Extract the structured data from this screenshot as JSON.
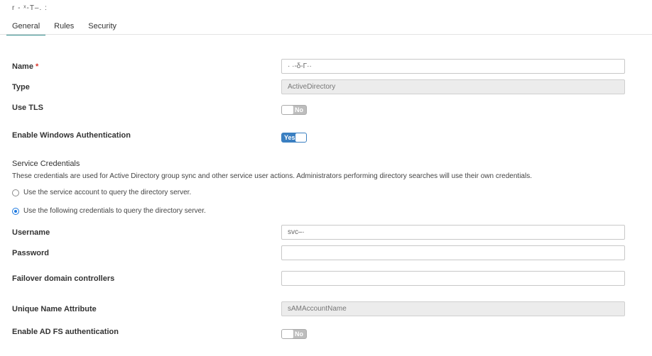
{
  "header": {
    "title": "r - ˣ-T–. :"
  },
  "tabs": [
    {
      "label": "General"
    },
    {
      "label": "Rules"
    },
    {
      "label": "Security"
    }
  ],
  "form": {
    "name": {
      "label": "Name",
      "required_marker": "*",
      "value": "· ·-δ-Γ··"
    },
    "type": {
      "label": "Type",
      "value": "ActiveDirectory"
    },
    "use_tls": {
      "label": "Use TLS",
      "state": "No"
    },
    "windows_auth": {
      "label": "Enable Windows Authentication",
      "state": "Yes"
    },
    "service_credentials": {
      "title": "Service Credentials",
      "description": "These credentials are used for Active Directory group sync and other service user actions. Administrators performing directory searches will use their own credentials.",
      "option_service_account": "Use the service account to query the directory server.",
      "option_following_credentials": "Use the following credentials to query the directory server.",
      "selected": "following"
    },
    "username": {
      "label": "Username",
      "value": "svc–·"
    },
    "password": {
      "label": "Password",
      "value": ""
    },
    "failover": {
      "label": "Failover domain controllers",
      "value": ""
    },
    "unique_name": {
      "label": "Unique Name Attribute",
      "value": "sAMAccountName"
    },
    "adfs": {
      "label": "Enable AD FS authentication",
      "state": "No"
    }
  },
  "colors": {
    "accent": "#2e8b8b",
    "toggle_on": "#3a7fc1",
    "required": "#d9342b"
  }
}
